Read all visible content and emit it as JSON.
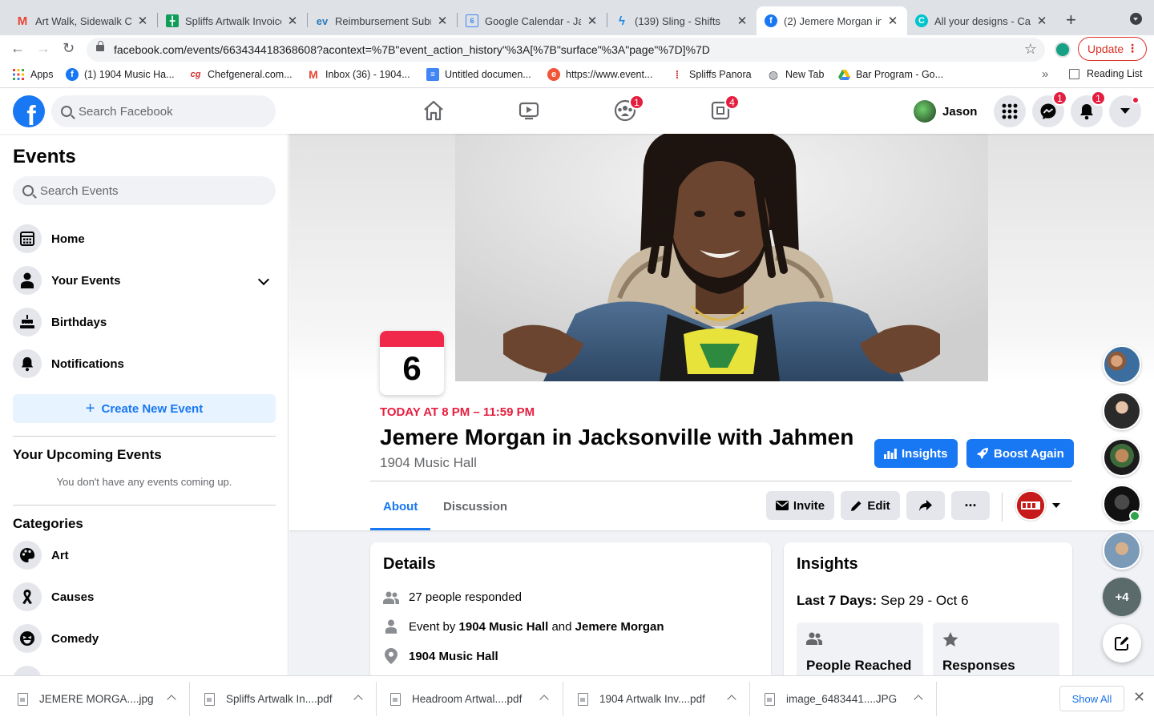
{
  "browser": {
    "tabs": [
      {
        "title": "Art Walk, Sidewalk Ca",
        "icon": "gmail-icon"
      },
      {
        "title": "Spliffs Artwalk Invoice",
        "icon": "sheets-icon"
      },
      {
        "title": "Reimbursement Subm",
        "icon": "ev-icon"
      },
      {
        "title": "Google Calendar - Ja",
        "icon": "calendar-icon"
      },
      {
        "title": "(139) Sling - Shifts",
        "icon": "sling-icon"
      },
      {
        "title": "(2) Jemere Morgan in",
        "icon": "facebook-icon"
      },
      {
        "title": "All your designs - Car",
        "icon": "canva-icon"
      }
    ],
    "url": "facebook.com/events/663434418368608?acontext=%7B\"event_action_history\"%3A[%7B\"surface\"%3A\"page\"%7D]%7D",
    "update_label": "Update",
    "bookmarks": [
      {
        "label": "Apps",
        "icon": "apps-grid-icon"
      },
      {
        "label": "(1) 1904 Music Ha...",
        "icon": "facebook-icon"
      },
      {
        "label": "Chefgeneral.com...",
        "icon": "chefgeneral-icon"
      },
      {
        "label": "Inbox (36) - 1904...",
        "icon": "gmail-icon"
      },
      {
        "label": "Untitled documen...",
        "icon": "docs-icon"
      },
      {
        "label": "https://www.event...",
        "icon": "eventbrite-icon"
      },
      {
        "label": "Spliffs Panora",
        "icon": "spliffs-icon"
      },
      {
        "label": "New Tab",
        "icon": "globe-icon"
      },
      {
        "label": "Bar Program - Go...",
        "icon": "drive-icon"
      }
    ],
    "bookmarks_more": "»",
    "reading_list": "Reading List"
  },
  "fb_header": {
    "logo": "f",
    "search_placeholder": "Search Facebook",
    "nav_badges": {
      "groups": "1",
      "gaming": "4"
    },
    "user_name": "Jason",
    "messenger_badge": "1",
    "notifications_badge": "1"
  },
  "sidebar": {
    "title": "Events",
    "search_placeholder": "Search Events",
    "items": [
      {
        "label": "Home",
        "icon": "calendar-grid-icon"
      },
      {
        "label": "Your Events",
        "icon": "person-icon"
      },
      {
        "label": "Birthdays",
        "icon": "cake-icon"
      },
      {
        "label": "Notifications",
        "icon": "bell-icon"
      }
    ],
    "create_label": "Create New Event",
    "upcoming_title": "Your Upcoming Events",
    "upcoming_empty": "You don't have any events coming up.",
    "categories_title": "Categories",
    "categories": [
      {
        "label": "Art",
        "icon": "palette-icon"
      },
      {
        "label": "Causes",
        "icon": "ribbon-icon"
      },
      {
        "label": "Comedy",
        "icon": "laugh-icon"
      }
    ]
  },
  "event": {
    "date_day": "6",
    "time": "TODAY AT 8 PM – 11:59 PM",
    "title": "Jemere Morgan in Jacksonville with Jahmen",
    "venue": "1904 Music Hall",
    "insights_button": "Insights",
    "boost_button": "Boost Again",
    "tabs": [
      "About",
      "Discussion"
    ],
    "invite_label": "Invite",
    "edit_label": "Edit",
    "more_label": "···"
  },
  "details": {
    "title": "Details",
    "responded": "27 people responded",
    "event_by_prefix": "Event by ",
    "host_1": "1904 Music Hall",
    "and_text": " and ",
    "host_2": "Jemere Morgan",
    "location": "1904 Music Hall"
  },
  "insights": {
    "title": "Insights",
    "range_label": "Last 7 Days:",
    "range_value": "Sep 29 - Oct 6",
    "stat_1": "People Reached",
    "stat_2": "Responses"
  },
  "contacts": {
    "more_label": "+4"
  },
  "downloads": {
    "files": [
      "JEMERE MORGA....jpg",
      "Spliffs Artwalk In....pdf",
      "Headroom Artwal....pdf",
      "1904 Artwalk Inv....pdf",
      "image_6483441....JPG"
    ],
    "show_all": "Show All"
  },
  "colors": {
    "facebook_blue": "#1877f2",
    "date_red": "#f02849",
    "badge_red": "#e41e3f"
  }
}
